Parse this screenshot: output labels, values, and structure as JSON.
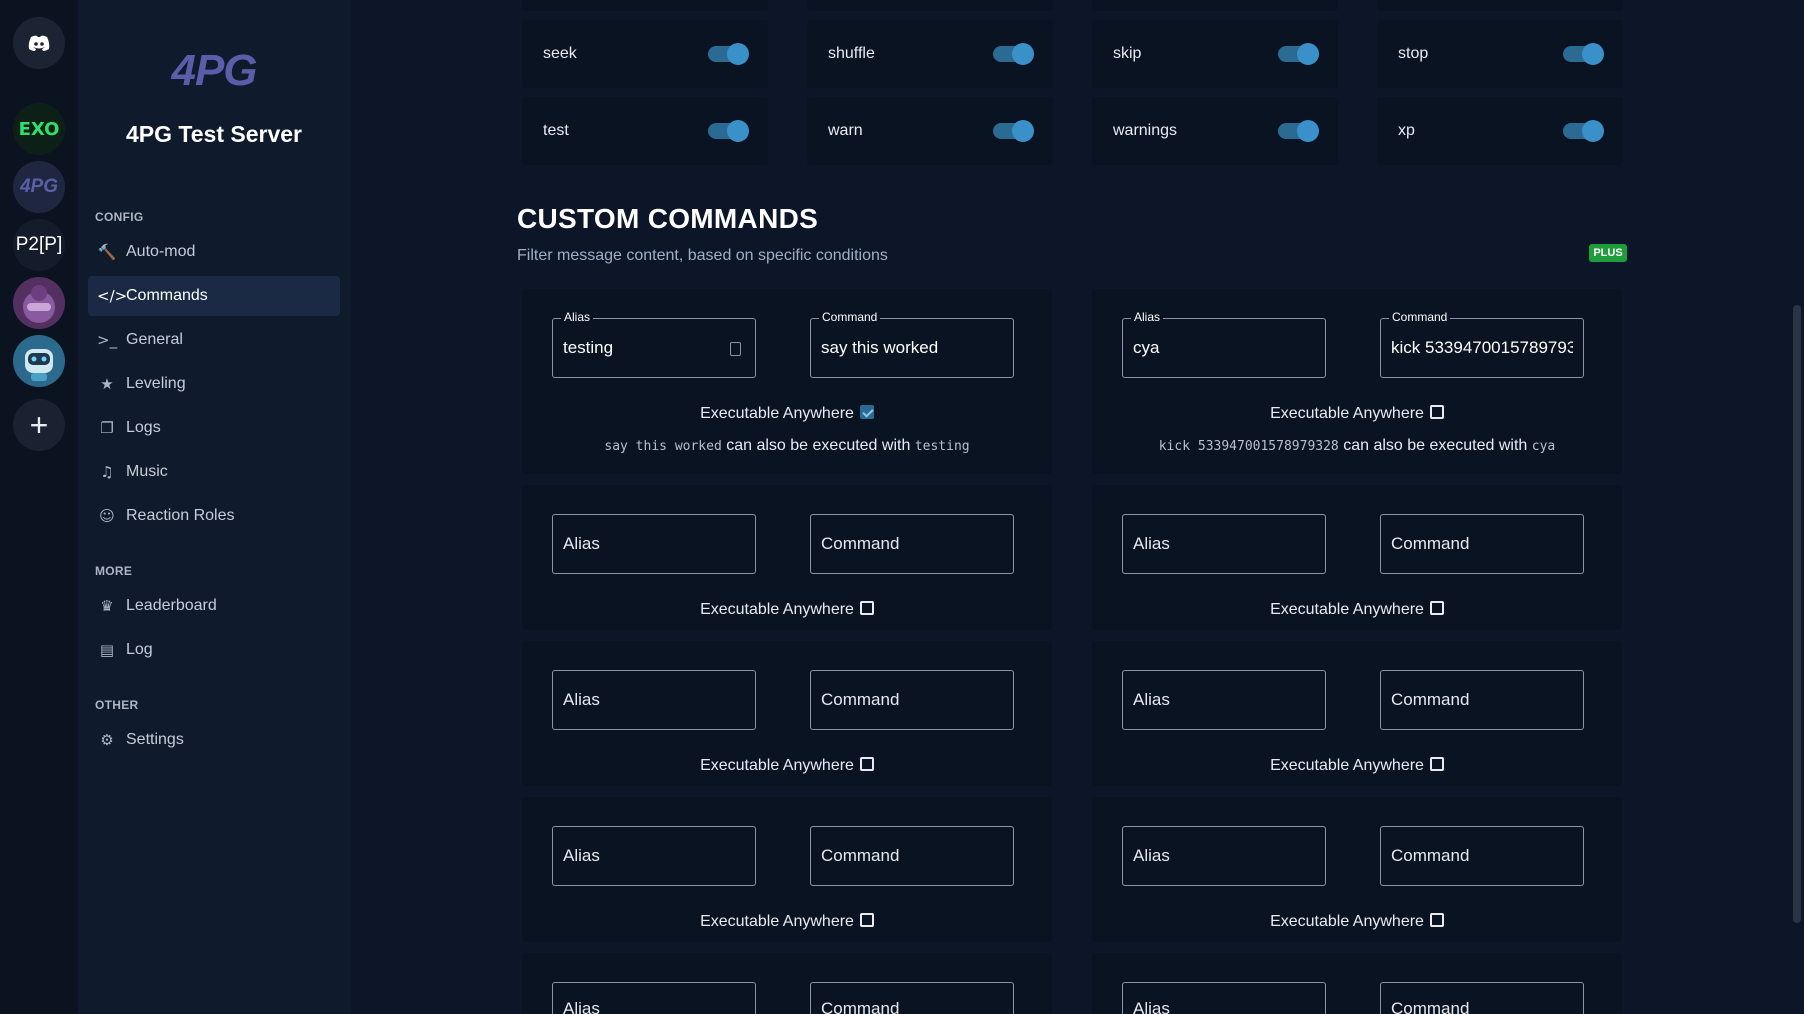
{
  "rail": {
    "guilds": [
      {
        "name": "discord-home",
        "text": ""
      },
      {
        "name": "exo",
        "text": "EXO"
      },
      {
        "name": "4pg",
        "text": "4PG"
      },
      {
        "name": "p2p",
        "text": "P2[P]"
      },
      {
        "name": "avatar-one",
        "text": ""
      },
      {
        "name": "avatar-two",
        "text": ""
      },
      {
        "name": "add",
        "text": "+"
      }
    ]
  },
  "sidebar": {
    "logo": "4PG",
    "server_name": "4PG Test Server",
    "sections": {
      "config": "CONFIG",
      "more": "MORE",
      "other": "OTHER"
    },
    "config_items": [
      {
        "label": "Auto-mod",
        "icon": "gavel-icon"
      },
      {
        "label": "Commands",
        "icon": "code-icon",
        "active": true
      },
      {
        "label": "General",
        "icon": "terminal-icon"
      },
      {
        "label": "Leveling",
        "icon": "star-icon"
      },
      {
        "label": "Logs",
        "icon": "clone-icon"
      },
      {
        "label": "Music",
        "icon": "music-icon"
      },
      {
        "label": "Reaction Roles",
        "icon": "mask-icon"
      }
    ],
    "more_items": [
      {
        "label": "Leaderboard",
        "icon": "trophy-icon"
      },
      {
        "label": "Log",
        "icon": "file-icon"
      }
    ],
    "other_items": [
      {
        "label": "Settings",
        "icon": "gear-icon"
      }
    ]
  },
  "toggles": [
    {
      "label": "seek",
      "on": true
    },
    {
      "label": "shuffle",
      "on": true
    },
    {
      "label": "skip",
      "on": true
    },
    {
      "label": "stop",
      "on": true
    },
    {
      "label": "test",
      "on": true
    },
    {
      "label": "warn",
      "on": true
    },
    {
      "label": "warnings",
      "on": true
    },
    {
      "label": "xp",
      "on": true
    }
  ],
  "custom": {
    "title": "CUSTOM COMMANDS",
    "subtitle": "Filter message content, based on specific conditions",
    "badge": "PLUS",
    "alias_legend": "Alias",
    "command_legend": "Command",
    "alias_placeholder": "Alias",
    "command_placeholder": "Command",
    "exec_label": "Executable Anywhere",
    "note_middle": "can also be executed with",
    "commands": [
      {
        "alias": "testing",
        "command": "say this worked",
        "anywhere": true
      },
      {
        "alias": "cya",
        "command": "kick 533947001578979328",
        "anywhere": false
      }
    ]
  },
  "colors": {
    "accent": "#2b6a93",
    "plus": "#1f9d3b",
    "background": "#0d1628",
    "card": "#0a1322"
  }
}
